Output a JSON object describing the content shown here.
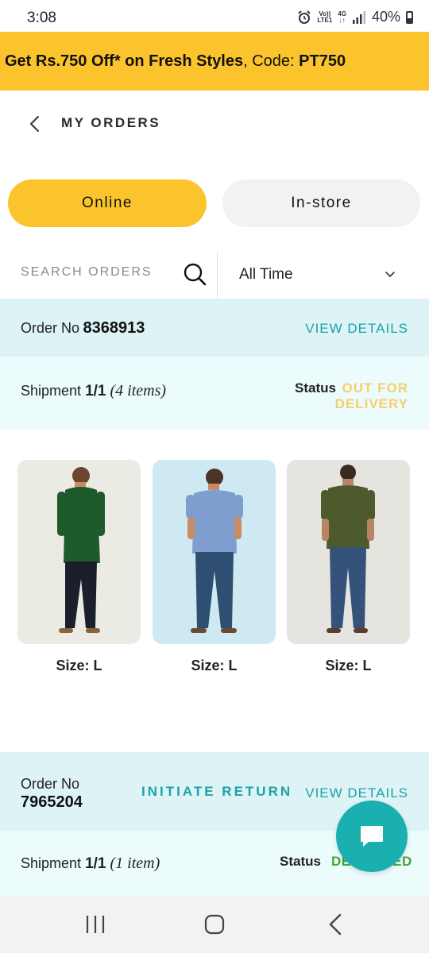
{
  "status_bar": {
    "time": "3:08",
    "network_small_top": "Vo))",
    "network_small_bottom": "LTE1",
    "network_type": "4G",
    "battery": "40%"
  },
  "promo": {
    "offer": "Get Rs.750 Off* on Fresh Styles",
    "code_label": ", Code: ",
    "code": "PT750"
  },
  "header": {
    "title": "MY ORDERS"
  },
  "tabs": {
    "online": "Online",
    "instore": "In-store",
    "active": "online"
  },
  "search": {
    "placeholder": "SEARCH ORDERS"
  },
  "filter": {
    "selected": "All Time"
  },
  "orders": [
    {
      "order_no_label": "Order No",
      "order_no": "8368913",
      "view_details": "VIEW DETAILS",
      "shipment_label": "Shipment",
      "shipment": "1/1",
      "items": "(4 items)",
      "status_label": "Status",
      "status": "OUT FOR DELIVERY",
      "products": [
        {
          "size": "Size: L",
          "shirt_color": "green shirt"
        },
        {
          "size": "Size: L",
          "shirt_color": "blue shirt"
        },
        {
          "size": "Size: L",
          "shirt_color": "olive shirt"
        }
      ]
    },
    {
      "order_no_label": "Order No",
      "order_no": "7965204",
      "initiate_return": "INITIATE RETURN",
      "view_details": "VIEW DETAILS",
      "shipment_label": "Shipment",
      "shipment": "1/1",
      "items": "(1 item)",
      "status_label": "Status",
      "status": "DELIVERED"
    }
  ],
  "colors": {
    "accent_yellow": "#fcc42c",
    "teal": "#1aa3a8",
    "order_header_bg": "#ddf3f5",
    "shipment_bg": "#ecfbfc",
    "status_out_for_delivery": "#f5cf6a",
    "status_delivered": "#3fa836"
  },
  "icons": {
    "back": "chevron-left-icon",
    "search": "search-icon",
    "dropdown": "chevron-down-icon",
    "chat": "chat-bubble-icon",
    "nav_recent": "recent-apps-icon",
    "nav_home": "home-icon",
    "nav_back": "back-icon"
  }
}
